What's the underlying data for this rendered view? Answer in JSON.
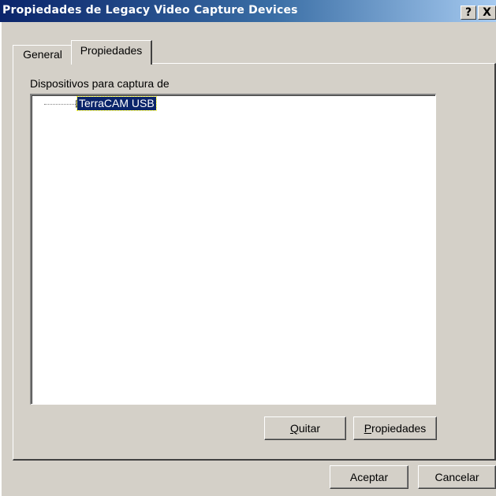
{
  "window": {
    "title": "Propiedades de Legacy Video Capture Devices",
    "help_button": "?",
    "close_button": "X"
  },
  "tabs": [
    {
      "label": "General",
      "active": false
    },
    {
      "label": "Propiedades",
      "active": true
    }
  ],
  "devices_panel": {
    "label": "Dispositivos para captura de",
    "items": [
      {
        "label": "TerraCAM USB",
        "icon": "video-capture-device-icon",
        "selected": true
      }
    ]
  },
  "panel_buttons": {
    "remove": {
      "accel": "Q",
      "rest": "uitar"
    },
    "properties": {
      "accel": "P",
      "rest": "ropiedades"
    }
  },
  "dialog_buttons": {
    "ok": "Aceptar",
    "cancel": "Cancelar"
  },
  "colors": {
    "titlebar_start": "#0a246a",
    "titlebar_end": "#a6caf0",
    "face": "#d4d0c8",
    "selection": "#0a246a"
  }
}
